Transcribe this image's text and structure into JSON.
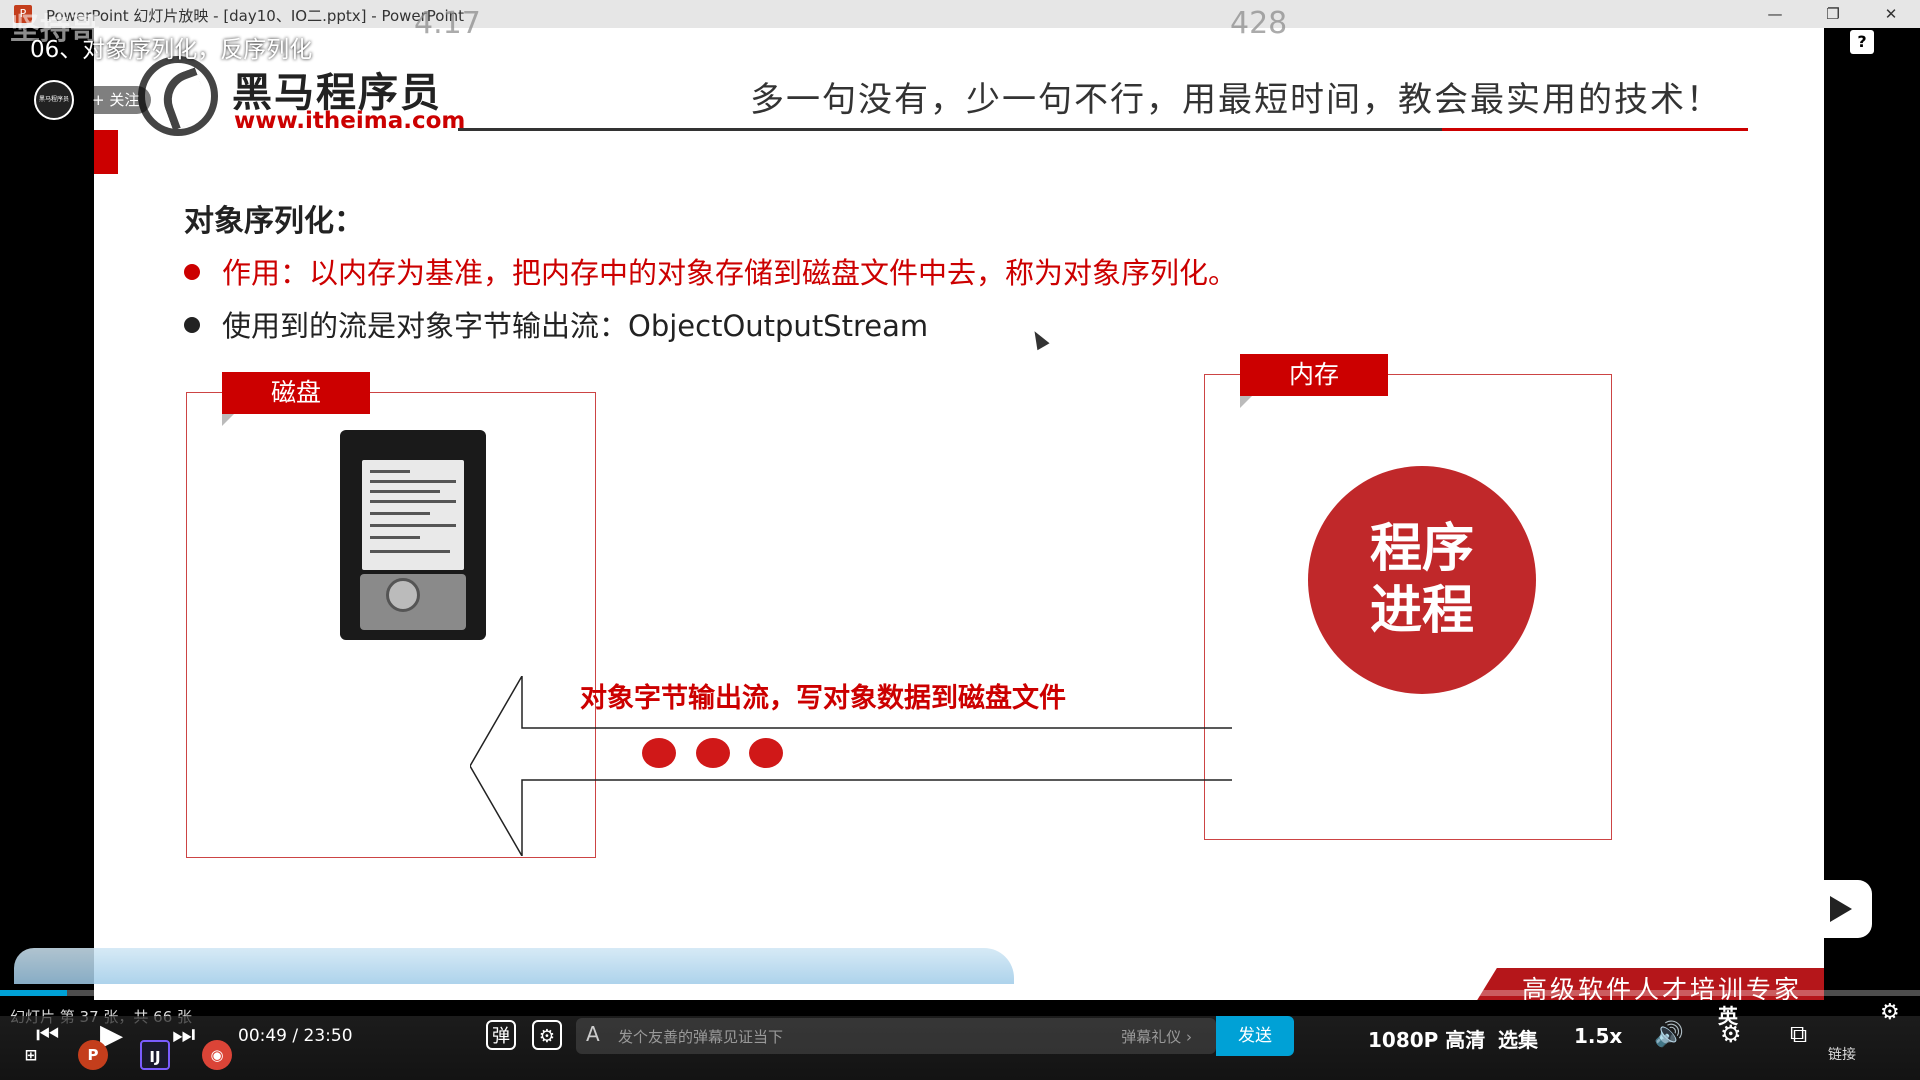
{
  "window": {
    "title": "PowerPoint 幻灯片放映 - [day10、IO二.pptx] - PowerPoint",
    "minimize": "—",
    "restore": "❐",
    "close": "✕"
  },
  "overlay": {
    "channel_watermark": "坚持哥",
    "video_title": "06、对象序列化，反序列化",
    "top_number_left": "4.17",
    "top_number_right": "428",
    "follow_label": "+ 关注",
    "avatar_text": "黑马程序员",
    "help_icon": "?"
  },
  "slide": {
    "brand_name": "黑马程序员",
    "brand_url": "www.itheima.com",
    "slogan": "多一句没有，少一句不行，用最短时间，教会最实用的技术！",
    "heading": "对象序列化：",
    "bullets": [
      "作用：以内存为基准，把内存中的对象存储到磁盘文件中去，称为对象序列化。",
      "使用到的流是对象字节输出流：ObjectOutputStream"
    ],
    "disk_label": "磁盘",
    "memory_label": "内存",
    "process_line1": "程序",
    "process_line2": "进程",
    "flow_caption": "对象字节输出流，写对象数据到磁盘文件",
    "footer_slogan": "高级软件人才培训专家",
    "accent_color": "#c00000"
  },
  "player": {
    "slide_status": "幻灯片 第 37 张，共 66 张",
    "time_current": "00:49",
    "time_sep": "/",
    "time_total": "23:50",
    "danmaku_placeholder": "发个友善的弹幕见证当下",
    "danmaku_etiquette": "弹幕礼仪 ›",
    "send_label": "发送",
    "quality": "1080P 高清",
    "episodes": "选集",
    "speed": "1.5x",
    "subtitle_lang": "英",
    "link_label": "链接",
    "progress_fraction": 0.035,
    "brand_color": "#00a1d6"
  }
}
